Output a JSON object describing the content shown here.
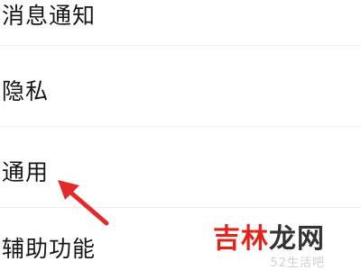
{
  "settings": {
    "items": [
      {
        "label": "消息通知"
      },
      {
        "label": "隐私"
      },
      {
        "label": "通用"
      },
      {
        "label": "辅助功能"
      }
    ]
  },
  "annotation": {
    "arrow_color": "#e12b2b",
    "arrow_target": "通用"
  },
  "watermark": {
    "brand_part1": "吉林",
    "brand_part2": "龙网",
    "brand_color_1": "#e2231a",
    "brand_color_2": "#333333",
    "sub": "52生活吧"
  }
}
